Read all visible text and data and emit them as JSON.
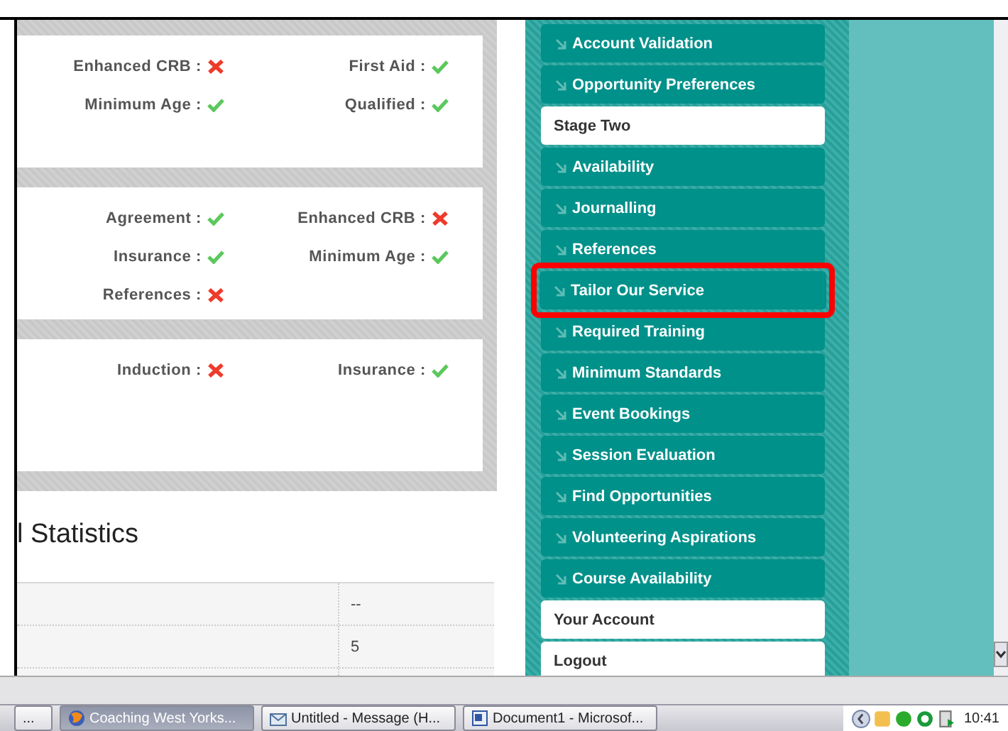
{
  "status_cards": [
    {
      "items": [
        {
          "label": "Enhanced CRB :",
          "passed": false
        },
        {
          "label": "First Aid :",
          "passed": true
        },
        {
          "label": "Minimum Age :",
          "passed": true
        },
        {
          "label": "Qualified :",
          "passed": true
        }
      ]
    },
    {
      "items": [
        {
          "label": "Agreement :",
          "passed": true
        },
        {
          "label": "Enhanced CRB :",
          "passed": false
        },
        {
          "label": "Insurance :",
          "passed": true
        },
        {
          "label": "Minimum Age :",
          "passed": true
        },
        {
          "label": "References :",
          "passed": false
        }
      ]
    },
    {
      "items": [
        {
          "label": "Induction :",
          "passed": false
        },
        {
          "label": "Insurance :",
          "passed": true
        }
      ]
    }
  ],
  "statistics": {
    "title": "l Statistics",
    "rows": [
      {
        "value": "--"
      },
      {
        "value": "5"
      }
    ]
  },
  "sidebar": {
    "items": [
      {
        "label": "Account Validation",
        "kind": "link",
        "highlighted": false
      },
      {
        "label": "Opportunity Preferences",
        "kind": "link",
        "highlighted": false
      },
      {
        "label": "Stage Two",
        "kind": "heading",
        "highlighted": false
      },
      {
        "label": "Availability",
        "kind": "link",
        "highlighted": false
      },
      {
        "label": "Journalling",
        "kind": "link",
        "highlighted": false
      },
      {
        "label": "References",
        "kind": "link",
        "highlighted": false
      },
      {
        "label": "Tailor Our Service",
        "kind": "link",
        "highlighted": true
      },
      {
        "label": "Required Training",
        "kind": "link",
        "highlighted": false
      },
      {
        "label": "Minimum Standards",
        "kind": "link",
        "highlighted": false
      },
      {
        "label": "Event Bookings",
        "kind": "link",
        "highlighted": false
      },
      {
        "label": "Session Evaluation",
        "kind": "link",
        "highlighted": false
      },
      {
        "label": "Find Opportunities",
        "kind": "link",
        "highlighted": false
      },
      {
        "label": "Volunteering Aspirations",
        "kind": "link",
        "highlighted": false
      },
      {
        "label": "Course Availability",
        "kind": "link",
        "highlighted": false
      },
      {
        "label": "Your Account",
        "kind": "heading",
        "highlighted": false
      },
      {
        "label": "Logout",
        "kind": "heading",
        "highlighted": false
      }
    ]
  },
  "taskbar": {
    "buttons": [
      {
        "label": "...",
        "kind": "plain",
        "selected": false
      },
      {
        "label": "Coaching West Yorks...",
        "kind": "browser",
        "selected": true
      },
      {
        "label": "Untitled - Message (H...",
        "kind": "mail",
        "selected": false
      },
      {
        "label": "Document1 - Microsof...",
        "kind": "document",
        "selected": false
      }
    ],
    "clock": "10:41"
  }
}
